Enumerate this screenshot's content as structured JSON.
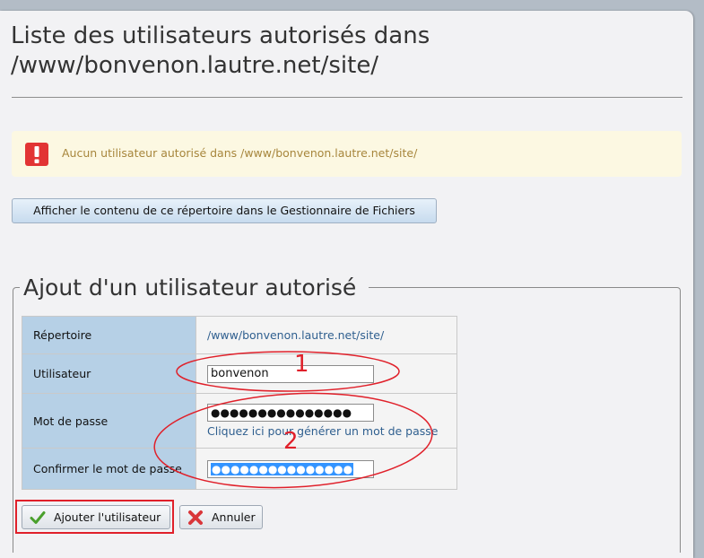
{
  "page": {
    "title_line1": "Liste des utilisateurs autorisés dans",
    "title_line2": "/www/bonvenon.lautre.net/site/"
  },
  "alert": {
    "icon": "exclamation-icon",
    "text": "Aucun utilisateur autorisé dans /www/bonvenon.lautre.net/site/",
    "color": "#a7863c"
  },
  "browse_button": {
    "label": "Afficher le contenu de ce répertoire dans le Gestionnaire de Fichiers"
  },
  "form": {
    "legend": "Ajout d'un utilisateur autorisé",
    "rows": {
      "directory_label": "Répertoire",
      "directory_value": "/www/bonvenon.lautre.net/site/",
      "user_label": "Utilisateur",
      "user_value": "bonvenon",
      "password_label": "Mot de passe",
      "password_value": "●●●●●●●●●●●●●●●",
      "generate_link": "Cliquez ici pour générer un mot de passe",
      "confirm_label": "Confirmer le mot de passe",
      "confirm_value": "●●●●●●●●●●●●●●●"
    },
    "add_button": "Ajouter l'utilisateur",
    "cancel_button": "Annuler"
  },
  "annotations": {
    "marker_1": "1",
    "marker_2": "2",
    "color": "#e0202a"
  }
}
